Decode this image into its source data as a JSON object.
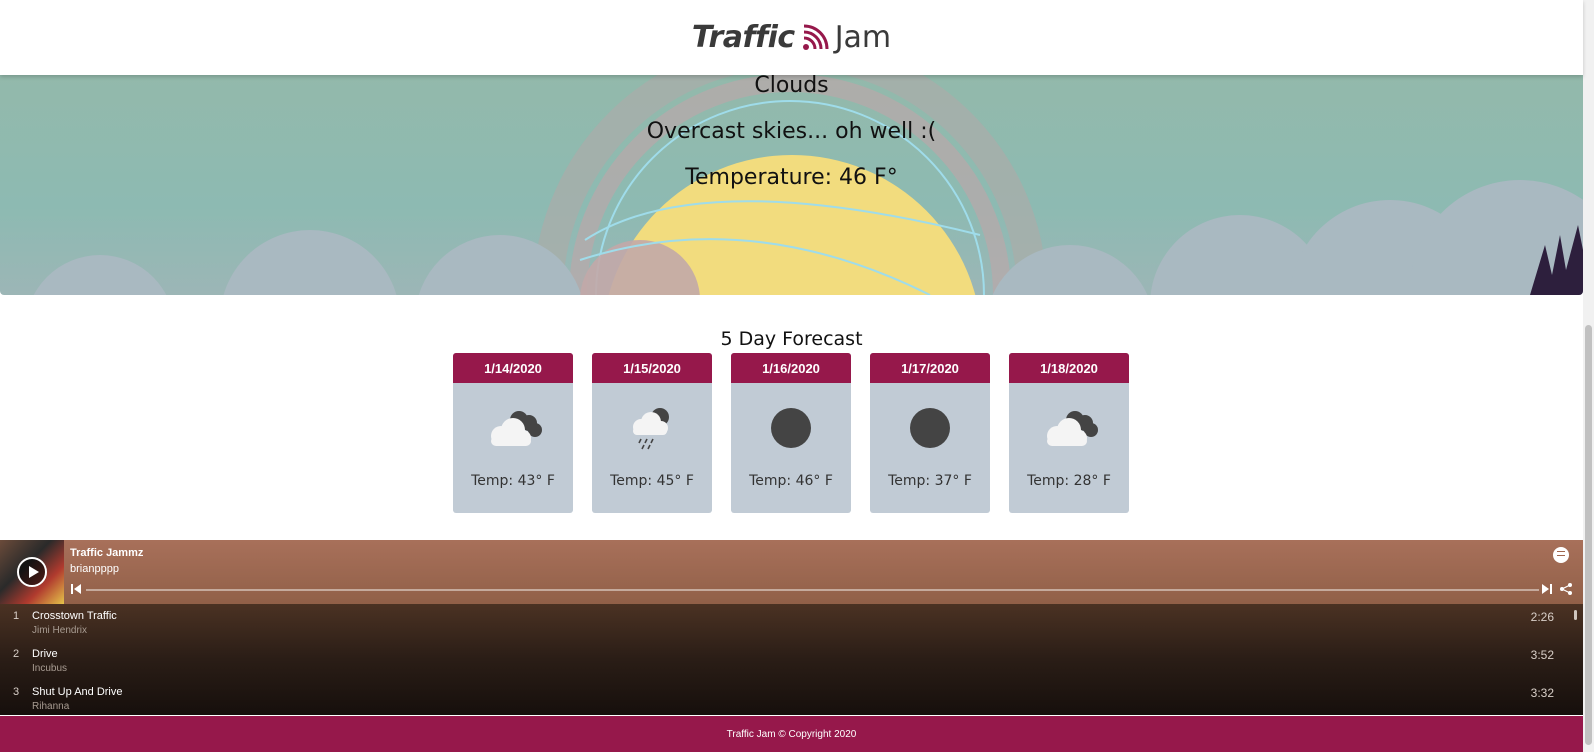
{
  "header": {
    "logo_bold": "Traffic",
    "logo_light": "Jam",
    "logo_icon": "rss-signal-icon",
    "accent_color": "#96184b"
  },
  "hero": {
    "condition": "Clouds",
    "description": "Overcast skies... oh well :(",
    "temperature": "Temperature: 46 F°"
  },
  "forecast": {
    "title": "5 Day Forecast",
    "days": [
      {
        "date": "1/14/2020",
        "icon": "partly-cloudy-icon",
        "temp": "Temp: 43° F"
      },
      {
        "date": "1/15/2020",
        "icon": "cloud-rain-icon",
        "temp": "Temp: 45° F"
      },
      {
        "date": "1/16/2020",
        "icon": "dark-circle-icon",
        "temp": "Temp: 46° F"
      },
      {
        "date": "1/17/2020",
        "icon": "dark-circle-icon",
        "temp": "Temp: 37° F"
      },
      {
        "date": "1/18/2020",
        "icon": "partly-cloudy-icon",
        "temp": "Temp: 28° F"
      }
    ]
  },
  "player": {
    "playlist_title": "Traffic Jammz",
    "owner": "brianpppp",
    "progress": 0,
    "tracks": [
      {
        "num": "1",
        "name": "Crosstown Traffic",
        "artist": "Jimi Hendrix",
        "duration": "2:26"
      },
      {
        "num": "2",
        "name": "Drive",
        "artist": "Incubus",
        "duration": "3:52"
      },
      {
        "num": "3",
        "name": "Shut Up And Drive",
        "artist": "Rihanna",
        "duration": "3:32"
      }
    ]
  },
  "footer": {
    "text": "Traffic Jam © Copyright 2020"
  }
}
